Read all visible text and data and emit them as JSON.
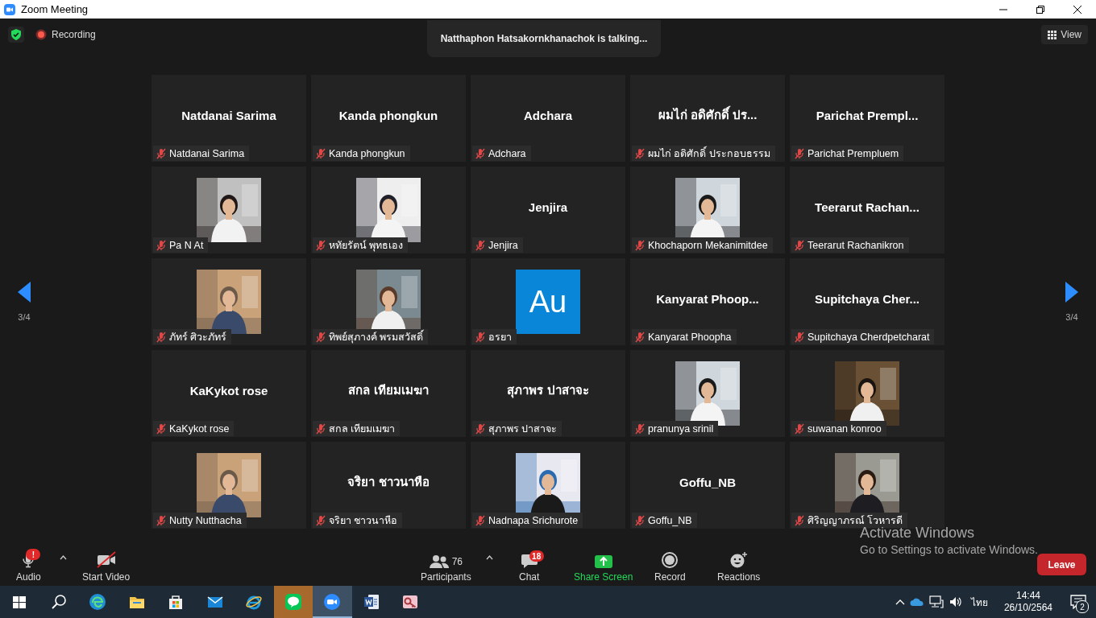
{
  "window": {
    "title": "Zoom Meeting"
  },
  "top_bar": {
    "recording_label": "Recording",
    "speaker_notice": "Natthaphon Hatsakornkhanachok is talking...",
    "view_button": "View"
  },
  "page_nav": {
    "left_page": "3/4",
    "right_page": "3/4"
  },
  "tiles": [
    {
      "kind": "name",
      "display_name": "Natdanai Sarima",
      "name_tag": "Natdanai Sarima",
      "muted": true
    },
    {
      "kind": "name",
      "display_name": "Kanda phongkun",
      "name_tag": "Kanda phongkun",
      "muted": true
    },
    {
      "kind": "name",
      "display_name": "Adchara",
      "name_tag": "Adchara",
      "muted": true
    },
    {
      "kind": "name",
      "display_name": "ผมไก่ อดิศักดิ์ ปร...",
      "name_tag": "ผมไก่ อดิศักดิ์ ประกอบธรรม",
      "muted": true
    },
    {
      "kind": "name",
      "display_name": "Parichat Prempl...",
      "name_tag": "Parichat Prempluem",
      "muted": true
    },
    {
      "kind": "picture",
      "name_tag": "Pa N At",
      "muted": true
    },
    {
      "kind": "picture",
      "name_tag": "หทัยรัตน์ พุทธเอง",
      "muted": true
    },
    {
      "kind": "name",
      "display_name": "Jenjira",
      "name_tag": "Jenjira",
      "muted": true
    },
    {
      "kind": "picture",
      "name_tag": "Khochaporn Mekanimitdee",
      "muted": true
    },
    {
      "kind": "name",
      "display_name": "Teerarut Rachan...",
      "name_tag": "Teerarut Rachanikron",
      "muted": true
    },
    {
      "kind": "picture",
      "name_tag": "ภัทร์ ศิวะภัทร์",
      "muted": true
    },
    {
      "kind": "picture",
      "name_tag": "ทิพย์สุภางค์ พรมสวัสดิ์",
      "muted": true
    },
    {
      "kind": "logo",
      "logo_text": "Au",
      "name_tag": "อรยา",
      "muted": true
    },
    {
      "kind": "name",
      "display_name": "Kanyarat Phoop...",
      "name_tag": "Kanyarat Phoopha",
      "muted": true
    },
    {
      "kind": "name",
      "display_name": "Supitchaya Cher...",
      "name_tag": "Supitchaya Cherdpetcharat",
      "muted": true
    },
    {
      "kind": "name",
      "display_name": "KaKykot rose",
      "name_tag": "KaKykot rose",
      "muted": true
    },
    {
      "kind": "name",
      "display_name": "สกล เทียมเมฆา",
      "name_tag": "สกล เทียมเมฆา",
      "muted": true
    },
    {
      "kind": "name",
      "display_name": "สุภาพร ปาสาจะ",
      "name_tag": "สุภาพร ปาสาจะ",
      "muted": true
    },
    {
      "kind": "picture",
      "name_tag": "pranunya srinil",
      "muted": true
    },
    {
      "kind": "picture",
      "name_tag": "suwanan konroo",
      "muted": true
    },
    {
      "kind": "picture",
      "name_tag": "Nutty Nutthacha",
      "muted": true
    },
    {
      "kind": "name",
      "display_name": "จริยา ชาวนาหือ",
      "name_tag": "จริยา ชาวนาหือ",
      "muted": true
    },
    {
      "kind": "picture",
      "name_tag": "Nadnapa Srichurote",
      "muted": true
    },
    {
      "kind": "name",
      "display_name": "Goffu_NB",
      "name_tag": "Goffu_NB",
      "muted": true
    },
    {
      "kind": "picture",
      "name_tag": "ศิริญญาภรณ์ โวหารดี",
      "muted": true
    }
  ],
  "toolbar": {
    "buttons": [
      {
        "kind": "audio",
        "label": "Audio",
        "badge": "!"
      },
      {
        "kind": "video",
        "label": "Start Video"
      },
      {
        "kind": "participants",
        "label": "Participants",
        "count": "76"
      },
      {
        "kind": "chat",
        "label": "Chat",
        "badge": "18"
      },
      {
        "kind": "share",
        "label": "Share Screen"
      },
      {
        "kind": "record",
        "label": "Record"
      },
      {
        "kind": "reactions",
        "label": "Reactions"
      }
    ],
    "leave_button": "Leave"
  },
  "os_notice": {
    "title": "Activate Windows",
    "text": "Go to Settings to activate Windows."
  },
  "taskbar": {
    "apps": [
      {
        "kind": "start",
        "flashing": false,
        "active": false
      },
      {
        "kind": "search",
        "flashing": false,
        "active": false
      },
      {
        "kind": "edge",
        "flashing": false,
        "active": false
      },
      {
        "kind": "explorer",
        "flashing": false,
        "active": false
      },
      {
        "kind": "store",
        "flashing": false,
        "active": false
      },
      {
        "kind": "mail",
        "flashing": false,
        "active": false
      },
      {
        "kind": "ie",
        "flashing": false,
        "active": false
      },
      {
        "kind": "line",
        "flashing": true,
        "active": false
      },
      {
        "kind": "zoom",
        "flashing": false,
        "active": true
      },
      {
        "kind": "word",
        "flashing": false,
        "active": false
      },
      {
        "kind": "access",
        "flashing": false,
        "active": false
      }
    ],
    "tray": {
      "language": "ไทย",
      "time": "14:44",
      "date": "26/10/2564",
      "notifications": "2"
    }
  }
}
